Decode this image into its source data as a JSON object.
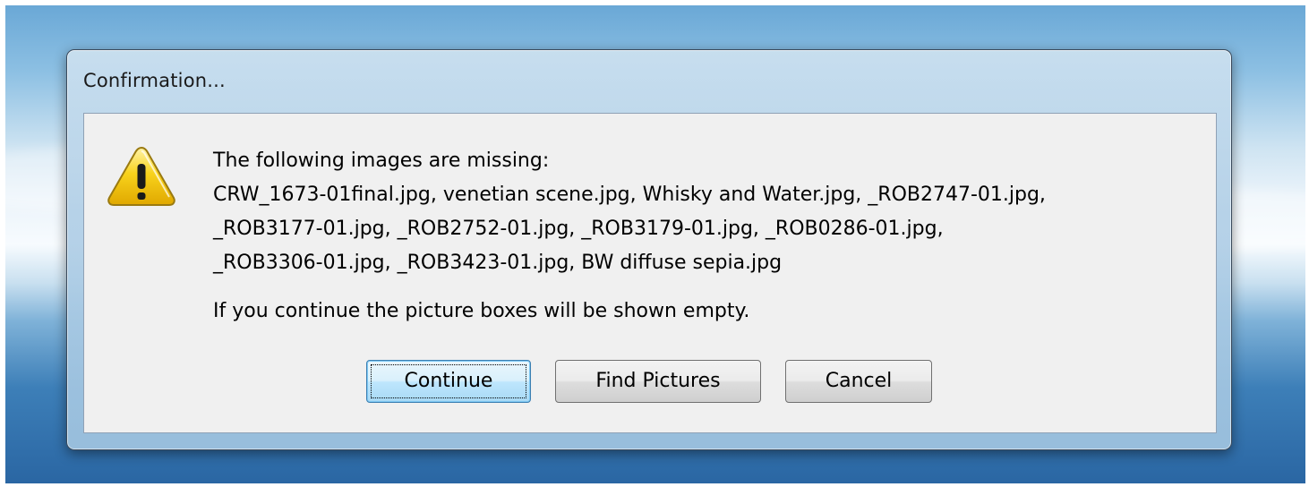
{
  "dialog": {
    "title": "Confirmation...",
    "icon": "warning-icon",
    "message_lines": [
      "The following images are missing:",
      "CRW_1673-01final.jpg, venetian scene.jpg, Whisky and Water.jpg, _ROB2747-01.jpg,",
      "_ROB3177-01.jpg, _ROB2752-01.jpg, _ROB3179-01.jpg, _ROB0286-01.jpg,",
      "_ROB3306-01.jpg, _ROB3423-01.jpg, BW diffuse sepia.jpg"
    ],
    "note": "If you continue the picture boxes will be shown empty.",
    "buttons": {
      "continue": "Continue",
      "find_pictures": "Find Pictures",
      "cancel": "Cancel"
    }
  },
  "colors": {
    "warning_fill": "#f5c400",
    "default_button_border": "#3c7fb1",
    "client_background": "#f0f0f0"
  }
}
